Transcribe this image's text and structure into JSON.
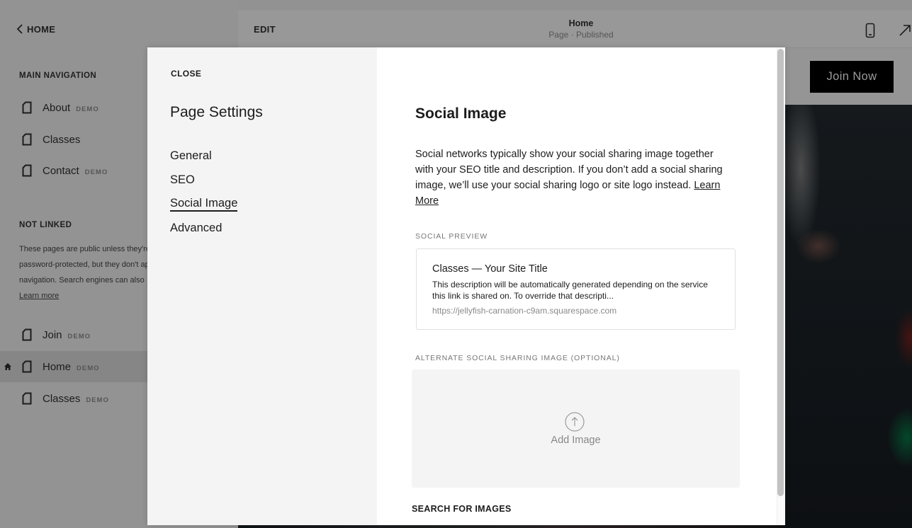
{
  "sidebar": {
    "back_label": "HOME",
    "main_nav_label": "MAIN NAVIGATION",
    "main_nav_items": [
      {
        "label": "About",
        "badge": "DEMO"
      },
      {
        "label": "Classes",
        "badge": ""
      },
      {
        "label": "Contact",
        "badge": "DEMO"
      }
    ],
    "not_linked_label": "NOT LINKED",
    "not_linked_desc_lines": [
      "These pages are public unless they're",
      "password-protected, but they don't appear in",
      "navigation. Search engines can also"
    ],
    "learn_more": "Learn more",
    "not_linked_items": [
      {
        "label": "Join",
        "badge": "DEMO",
        "active": false,
        "is_home": false
      },
      {
        "label": "Home",
        "badge": "DEMO",
        "active": true,
        "is_home": true
      },
      {
        "label": "Classes",
        "badge": "DEMO",
        "active": false,
        "is_home": false
      }
    ]
  },
  "editbar": {
    "edit_label": "EDIT",
    "page_title": "Home",
    "page_status": "Page · Published",
    "icons": [
      "mobile-preview-icon",
      "open-external-icon"
    ]
  },
  "site_preview": {
    "cta_label": "Join Now"
  },
  "modal": {
    "close_label": "CLOSE",
    "title": "Page Settings",
    "tabs": [
      {
        "label": "General",
        "active": false
      },
      {
        "label": "SEO",
        "active": false
      },
      {
        "label": "Social Image",
        "active": true
      },
      {
        "label": "Advanced",
        "active": false
      }
    ],
    "section_title": "Social Image",
    "description": "Social networks typically show your social sharing image together with your SEO title and description. If you don’t add a social sharing image, we’ll use your social sharing logo or site logo instead. ",
    "description_link": "Learn More",
    "social_preview_label": "SOCIAL PREVIEW",
    "preview": {
      "title": "Classes — Your Site Title",
      "description": "This description will be automatically generated depending on the service this link is shared on. To override that descripti...",
      "url": "https://jellyfish-carnation-c9am.squarespace.com"
    },
    "alt_image_label": "ALTERNATE SOCIAL SHARING IMAGE (OPTIONAL)",
    "add_image_label": "Add Image",
    "search_images_label": "SEARCH FOR IMAGES"
  }
}
